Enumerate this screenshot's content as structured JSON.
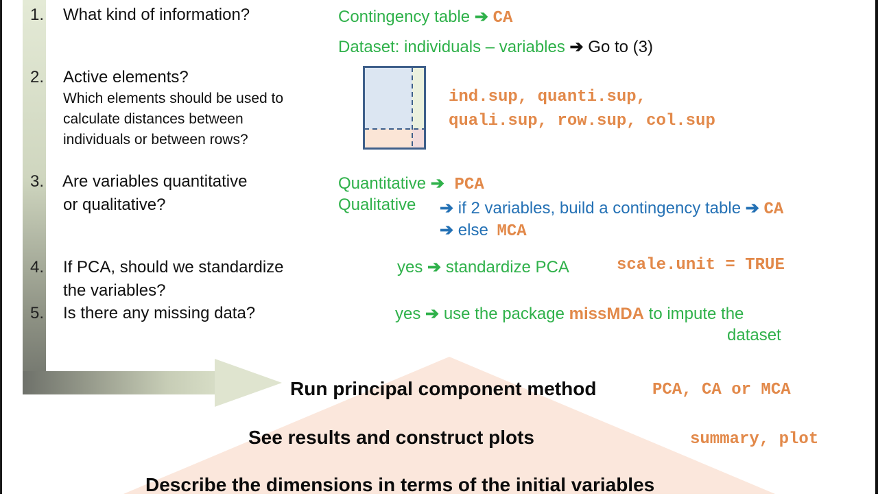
{
  "steps": [
    {
      "num": "1.",
      "question": "What kind of information?"
    },
    {
      "num": "2.",
      "question": "Active elements?",
      "sub_lines": [
        "Which elements should be used to",
        "calculate distances between",
        "individuals or between rows?"
      ]
    },
    {
      "num": "3.",
      "question_lines": [
        "Are variables quantitative",
        "or qualitative?"
      ]
    },
    {
      "num": "4.",
      "question_lines": [
        "If PCA, should we standardize",
        "the variables?"
      ]
    },
    {
      "num": "5.",
      "question": "Is there any missing data?"
    }
  ],
  "answers": {
    "info": {
      "contingency": {
        "label": "Contingency table",
        "arrow": "➔",
        "method": "CA"
      },
      "dataset": {
        "label": "Dataset: individuals – variables",
        "arrow": "➔",
        "goto": "Go to (3)"
      }
    },
    "active": {
      "code_lines": [
        "ind.sup, quanti.sup,",
        "quali.sup, row.sup, col.sup"
      ]
    },
    "type": {
      "quantitative": {
        "label": "Quantitative",
        "arrow": "➔",
        "method": "PCA"
      },
      "qualitative": {
        "label": "Qualitative"
      },
      "if_two": {
        "arrow": "➔",
        "text": "if 2 variables, build a contingency table",
        "arrow2": "➔",
        "method": "CA"
      },
      "else": {
        "arrow": "➔",
        "text": "else",
        "method": "MCA"
      }
    },
    "standardize": {
      "yes": "yes",
      "arrow": "➔",
      "text": "standardize PCA",
      "code": "scale.unit = TRUE"
    },
    "missing": {
      "yes": "yes",
      "arrow": "➔",
      "text_before": "use the package",
      "package": "missMDA",
      "text_after": "to impute the",
      "line2": "dataset"
    }
  },
  "pyramid": {
    "run": {
      "label": "Run principal component method",
      "code": "PCA, CA or MCA"
    },
    "results": {
      "label": "See results and construct plots",
      "code": "summary, plot"
    },
    "describe": {
      "label": "Describe the dimensions in terms of the initial variables"
    }
  },
  "colors": {
    "green": "#2fb14a",
    "blue": "#2471b5",
    "orange": "#e2894a",
    "matrix_border": "#3e5f8a",
    "matrix_active": "#dce6f2",
    "matrix_col_sup": "#ebf1de",
    "matrix_row_sup": "#fbe5d6",
    "matrix_both_sup": "#f2dbdb"
  }
}
